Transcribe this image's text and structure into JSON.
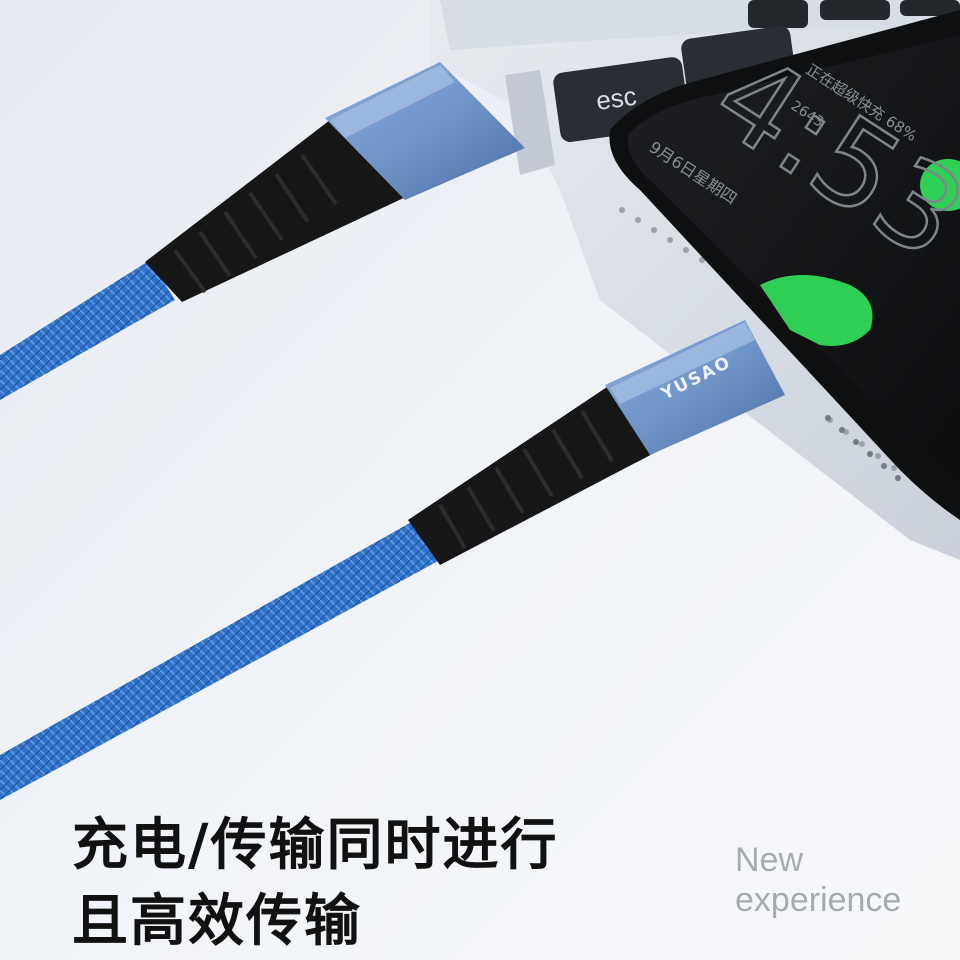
{
  "headline": {
    "line1": "充电/传输同时进行",
    "line2": "且高效传输"
  },
  "tagline": {
    "line1": "New",
    "line2": "experience"
  },
  "keyboard": {
    "esc_key_label": "esc"
  },
  "phone_lockscreen": {
    "status_text": "正在超级快充 68%",
    "step_count": "2643",
    "time": "4:53",
    "date": "9月6日星期四"
  },
  "cable": {
    "brand": "YUSAO"
  },
  "colors": {
    "background": "#eef2f7",
    "cable_blue": "#2f72c8",
    "connector_blue": "#6f94c8",
    "strain_relief_black": "#161616",
    "screen_green": "#2fcf55",
    "headline_text": "#111111",
    "tagline_text": "#a7abb1"
  }
}
